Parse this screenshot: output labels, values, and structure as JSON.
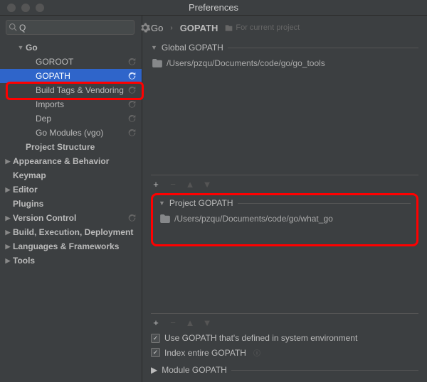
{
  "window": {
    "title": "Preferences"
  },
  "search": {
    "placeholder": "",
    "prefix": "Q"
  },
  "breadcrumb": {
    "a": "Go",
    "b": "GOPATH",
    "hint": "For current project"
  },
  "tree": [
    {
      "label": "Go",
      "depth": 1,
      "bold": true,
      "arrow": "▼",
      "reset": false
    },
    {
      "label": "GOROOT",
      "depth": 2,
      "reset": true
    },
    {
      "label": "GOPATH",
      "depth": 2,
      "reset": true,
      "selected": true
    },
    {
      "label": "Build Tags & Vendoring",
      "depth": 2,
      "reset": true
    },
    {
      "label": "Imports",
      "depth": 2,
      "reset": true
    },
    {
      "label": "Dep",
      "depth": 2,
      "reset": true
    },
    {
      "label": "Go Modules (vgo)",
      "depth": 2,
      "reset": true
    },
    {
      "label": "Project Structure",
      "depth": 1,
      "bold": true
    },
    {
      "label": "Appearance & Behavior",
      "depth": 0,
      "bold": true,
      "arrow": "▶"
    },
    {
      "label": "Keymap",
      "depth": 0,
      "bold": true
    },
    {
      "label": "Editor",
      "depth": 0,
      "bold": true,
      "arrow": "▶"
    },
    {
      "label": "Plugins",
      "depth": 0,
      "bold": true
    },
    {
      "label": "Version Control",
      "depth": 0,
      "bold": true,
      "arrow": "▶",
      "reset": true
    },
    {
      "label": "Build, Execution, Deployment",
      "depth": 0,
      "bold": true,
      "arrow": "▶"
    },
    {
      "label": "Languages & Frameworks",
      "depth": 0,
      "bold": true,
      "arrow": "▶"
    },
    {
      "label": "Tools",
      "depth": 0,
      "bold": true,
      "arrow": "▶"
    }
  ],
  "global": {
    "title": "Global GOPATH",
    "paths": [
      "/Users/pzqu/Documents/code/go/go_tools"
    ]
  },
  "project": {
    "title": "Project GOPATH",
    "paths": [
      "/Users/pzqu/Documents/code/go/what_go"
    ]
  },
  "checks": {
    "use_env": "Use GOPATH that's defined in system environment",
    "index_all": "Index entire GOPATH"
  },
  "module_section": "Module GOPATH"
}
